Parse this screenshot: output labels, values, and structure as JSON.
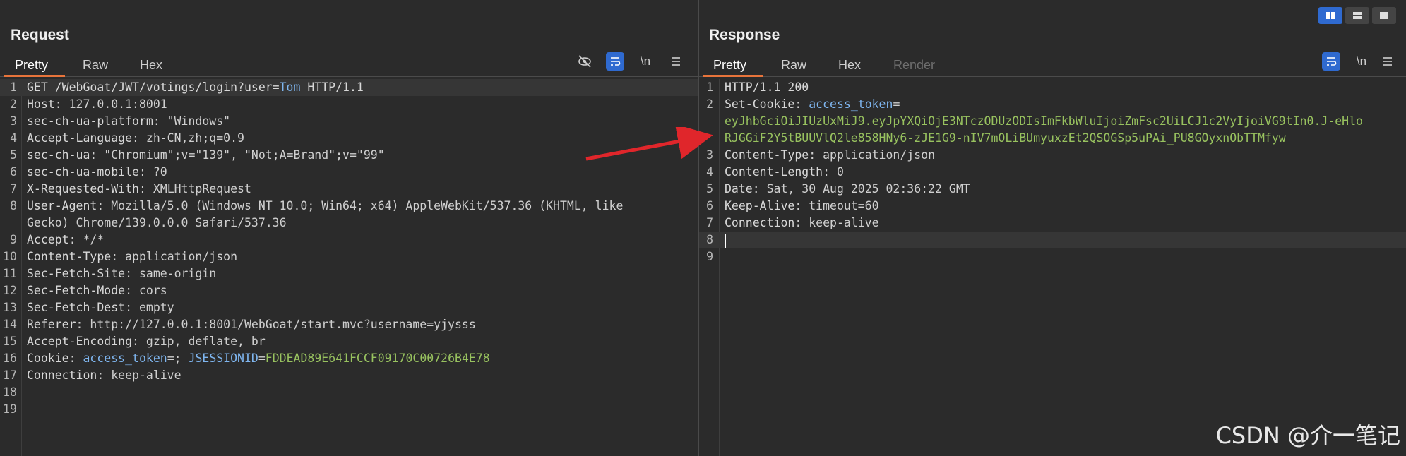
{
  "request": {
    "title": "Request",
    "tabs": [
      "Pretty",
      "Raw",
      "Hex"
    ],
    "tools": [
      "eye-off-icon",
      "wrap-icon",
      "\\n",
      "menu-icon"
    ],
    "lines": [
      {
        "n": "1",
        "k": "GET /WebGoat/JWT/votings/login?user=",
        "v": "",
        "extra": "Tom",
        "tail": " HTTP/1.1"
      },
      {
        "n": "2",
        "k": "Host",
        "v": ": 127.0.0.1:8001"
      },
      {
        "n": "3",
        "k": "sec-ch-ua-platform",
        "v": ": \"Windows\""
      },
      {
        "n": "4",
        "k": "Accept-Language",
        "v": ": zh-CN,zh;q=0.9"
      },
      {
        "n": "5",
        "k": "sec-ch-ua",
        "v": ": \"Chromium\";v=\"139\", \"Not;A=Brand\";v=\"99\""
      },
      {
        "n": "6",
        "k": "sec-ch-ua-mobile",
        "v": ": ?0"
      },
      {
        "n": "7",
        "k": "X-Requested-With",
        "v": ": XMLHttpRequest"
      },
      {
        "n": "8",
        "k": "User-Agent",
        "v": ": Mozilla/5.0 (Windows NT 10.0; Win64; x64) AppleWebKit/537.36 (KHTML, like"
      },
      {
        "n": "",
        "k": "",
        "v": "Gecko) Chrome/139.0.0.0 Safari/537.36"
      },
      {
        "n": "9",
        "k": "Accept",
        "v": ": */*"
      },
      {
        "n": "10",
        "k": "Content-Type",
        "v": ": application/json"
      },
      {
        "n": "11",
        "k": "Sec-Fetch-Site",
        "v": ": same-origin"
      },
      {
        "n": "12",
        "k": "Sec-Fetch-Mode",
        "v": ": cors"
      },
      {
        "n": "13",
        "k": "Sec-Fetch-Dest",
        "v": ": empty"
      },
      {
        "n": "14",
        "k": "Referer",
        "v": ": http://127.0.0.1:8001/WebGoat/start.mvc?username=yjysss"
      },
      {
        "n": "15",
        "k": "Accept-Encoding",
        "v": ": gzip, deflate, br"
      },
      {
        "n": "16",
        "k": "Cookie",
        "v": ": ",
        "cookie": "access_token",
        "c2": "=; ",
        "cookie2": "JSESSIONID",
        "c3": "=",
        "cval": "FDDEAD89E641FCCF09170C00726B4E78"
      },
      {
        "n": "17",
        "k": "Connection",
        "v": ": keep-alive"
      },
      {
        "n": "18",
        "k": "",
        "v": ""
      },
      {
        "n": "19",
        "k": "",
        "v": ""
      }
    ]
  },
  "response": {
    "title": "Response",
    "tabs": [
      "Pretty",
      "Raw",
      "Hex",
      "Render"
    ],
    "tools": [
      "wrap-icon",
      "\\n",
      "menu-icon"
    ],
    "view_toggles": [
      "split-view-icon",
      "horizontal-view-icon",
      "single-view-icon"
    ],
    "lines": [
      {
        "n": "1",
        "k": "HTTP/1.1 200",
        "v": ""
      },
      {
        "n": "2",
        "k": "Set-Cookie",
        "v": ": ",
        "cookie": "access_token",
        "c2": "="
      },
      {
        "n": "",
        "k": "",
        "v": "",
        "cval": "eyJhbGciOiJIUzUxMiJ9.eyJpYXQiOjE3NTczODUzODIsImFkbWluIjoiZmFsc2UiLCJ1c2VyIjoiVG9tIn0.J-eHlo"
      },
      {
        "n": "",
        "k": "",
        "v": "",
        "cval": "RJGGiF2Y5tBUUVlQ2le858HNy6-zJE1G9-nIV7mOLiBUmyuxzEt2QSOGSp5uPAi_PU8GOyxnObTTMfyw"
      },
      {
        "n": "3",
        "k": "Content-Type",
        "v": ": application/json"
      },
      {
        "n": "4",
        "k": "Content-Length",
        "v": ": 0"
      },
      {
        "n": "5",
        "k": "Date",
        "v": ": Sat, 30 Aug 2025 02:36:22 GMT"
      },
      {
        "n": "6",
        "k": "Keep-Alive",
        "v": ": timeout=60"
      },
      {
        "n": "7",
        "k": "Connection",
        "v": ": keep-alive"
      },
      {
        "n": "8",
        "k": "",
        "v": ""
      },
      {
        "n": "9",
        "k": "",
        "v": ""
      }
    ]
  },
  "watermark": "CSDN @介一笔记",
  "colors": {
    "accent": "#e8743b",
    "header_blue": "#7fb6f0",
    "value_green": "#98c25f",
    "arrow_red": "#e0262b",
    "toggle_blue": "#2f6ad0"
  }
}
